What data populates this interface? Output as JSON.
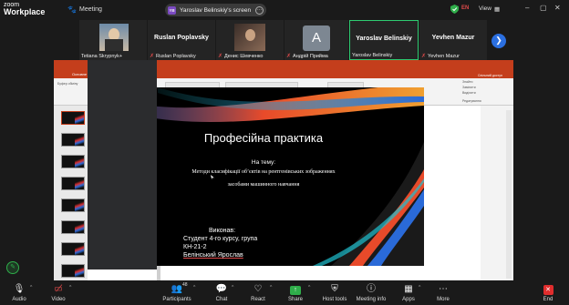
{
  "app": {
    "logo_line1": "zoom",
    "logo_line2": "Workplace",
    "meeting_label": "Meeting",
    "lang": "EN",
    "view_label": "View"
  },
  "share_pill": {
    "badge": "YB",
    "text": "Yaroslav Belinskiy's screen"
  },
  "participants": [
    {
      "name": "Tetiana Skrypnyk+",
      "big": "",
      "muted": false,
      "has_photo": true
    },
    {
      "name": "Ruslan Poplavsky",
      "big": "Ruslan Poplavsky",
      "muted": true
    },
    {
      "name": "Денис Шевченко",
      "big": "",
      "muted": true,
      "has_photo": true
    },
    {
      "name": "Андрій Приймa",
      "big": "A",
      "muted": true
    },
    {
      "name": "Yaroslav Belinskiy",
      "big": "Yaroslav Belinskiy",
      "muted": false,
      "active": true
    },
    {
      "name": "Yevhen Mazur",
      "big": "Yevhen Mazur",
      "muted": true
    }
  ],
  "ppt": {
    "tabs": [
      "Основне",
      "Вставлення",
      "Конструктор"
    ],
    "ribbon_groups": [
      "Буфер обміну",
      "Шрифт",
      "Малювання",
      "Редагування"
    ],
    "ribbon_items": [
      "Упорядкування",
      "Знайти",
      "Замінити",
      "Виділити",
      "Спільний доступ"
    ]
  },
  "slide": {
    "title": "Професійна практика",
    "subtitle": "На тему:",
    "line1": "Методи класифікації об’єктів на рентгенівських зображеннях",
    "line2": "засобами машинного навчання",
    "author_label": "Виконав:",
    "author_line1": "Студент 4-го курсу, група",
    "author_line2": "КН-21-2",
    "author_line3": "Белінський Ярослав"
  },
  "toolbar": [
    {
      "id": "audio",
      "label": "Audio",
      "icon": "mic-icon",
      "glyph": "🎙"
    },
    {
      "id": "video",
      "label": "Video",
      "icon": "video-off-icon",
      "glyph": "⛔"
    },
    {
      "id": "participants",
      "label": "Participants",
      "icon": "participants-icon",
      "glyph": "👥",
      "count": "48"
    },
    {
      "id": "chat",
      "label": "Chat",
      "icon": "chat-icon",
      "glyph": "💬"
    },
    {
      "id": "react",
      "label": "React",
      "icon": "react-icon",
      "glyph": "♡"
    },
    {
      "id": "share",
      "label": "Share",
      "icon": "share-icon",
      "glyph": "↑"
    },
    {
      "id": "host_tools",
      "label": "Host tools",
      "icon": "shield-icon",
      "glyph": "⛨"
    },
    {
      "id": "meeting_info",
      "label": "Meeting info",
      "icon": "info-icon",
      "glyph": "ⓘ"
    },
    {
      "id": "apps",
      "label": "Apps",
      "icon": "apps-icon",
      "glyph": "▦"
    },
    {
      "id": "more",
      "label": "More",
      "icon": "more-icon",
      "glyph": "⋯"
    },
    {
      "id": "end",
      "label": "End",
      "icon": "end-icon",
      "glyph": "✕"
    }
  ],
  "colors": {
    "accent": "#2b6fe0",
    "active_border": "#2ecc71",
    "ppt_red": "#c43e1c",
    "mute_red": "#e04a4a",
    "share_green": "#2fae4a"
  }
}
